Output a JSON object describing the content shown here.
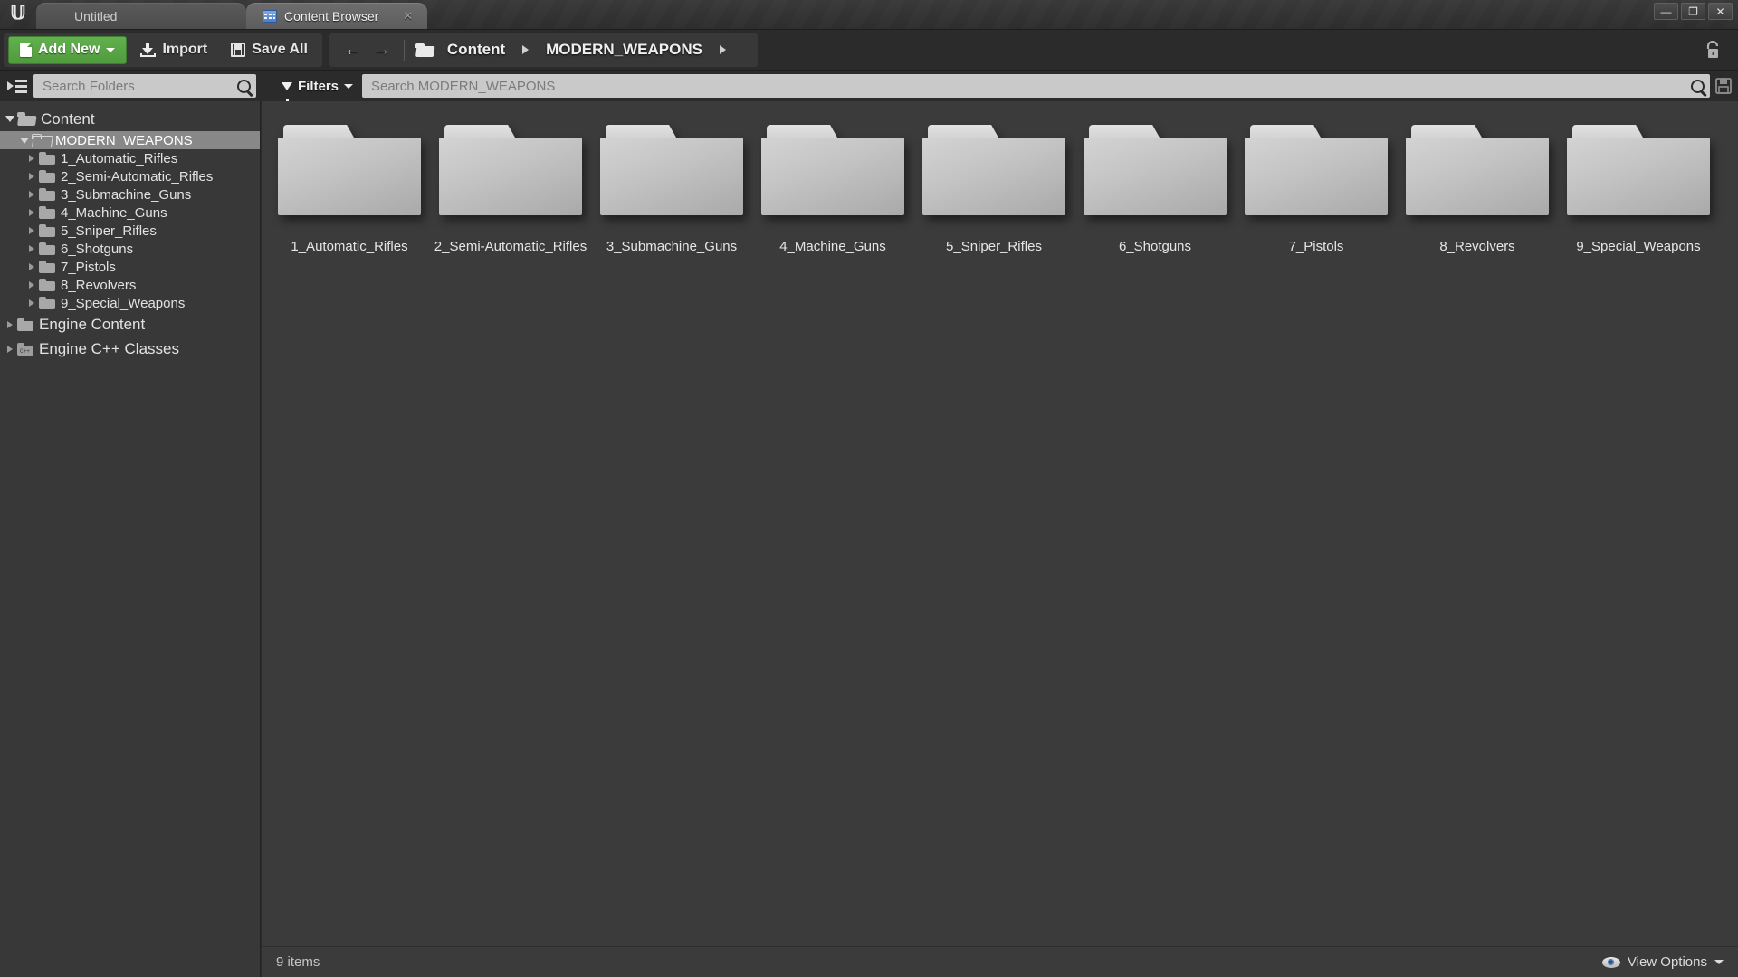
{
  "window": {
    "logo": "unreal-engine-logo",
    "controls": [
      {
        "name": "minimize-button",
        "glyph": "—"
      },
      {
        "name": "restore-button",
        "glyph": "❐"
      },
      {
        "name": "close-button",
        "glyph": "✕"
      }
    ]
  },
  "tabs": [
    {
      "label": "Untitled",
      "active": false,
      "icon": null
    },
    {
      "label": "Content Browser",
      "active": true,
      "icon": "content-browser-icon",
      "close": "✕"
    }
  ],
  "toolbar": {
    "add_new_label": "Add New",
    "import_label": "Import",
    "save_all_label": "Save All",
    "back_arrow": "←",
    "forward_arrow": "→",
    "lock_icon": "unlocked-padlock-icon"
  },
  "breadcrumb": {
    "folder_icon": "open-folder-icon",
    "items": [
      "Content",
      "MODERN_WEAPONS"
    ],
    "separator": "▶"
  },
  "search": {
    "folder_placeholder": "Search Folders",
    "folder_value": "",
    "asset_placeholder": "Search MODERN_WEAPONS",
    "asset_value": "",
    "filters_label": "Filters",
    "save_search_icon": "save-search-icon",
    "panel_toggle_icon": "collapse-panel-icon"
  },
  "sidebar": {
    "items": [
      {
        "label": "Content",
        "level": 0,
        "expanded": true,
        "selected": false,
        "icon": "open-folder-icon"
      },
      {
        "label": "MODERN_WEAPONS",
        "level": 1,
        "expanded": true,
        "selected": true,
        "icon": "open-folder-outline-icon"
      },
      {
        "label": "1_Automatic_Rifles",
        "level": 2,
        "expanded": false,
        "selected": false,
        "icon": "folder-icon"
      },
      {
        "label": "2_Semi-Automatic_Rifles",
        "level": 2,
        "expanded": false,
        "selected": false,
        "icon": "folder-icon"
      },
      {
        "label": "3_Submachine_Guns",
        "level": 2,
        "expanded": false,
        "selected": false,
        "icon": "folder-icon"
      },
      {
        "label": "4_Machine_Guns",
        "level": 2,
        "expanded": false,
        "selected": false,
        "icon": "folder-icon"
      },
      {
        "label": "5_Sniper_Rifles",
        "level": 2,
        "expanded": false,
        "selected": false,
        "icon": "folder-icon"
      },
      {
        "label": "6_Shotguns",
        "level": 2,
        "expanded": false,
        "selected": false,
        "icon": "folder-icon"
      },
      {
        "label": "7_Pistols",
        "level": 2,
        "expanded": false,
        "selected": false,
        "icon": "folder-icon"
      },
      {
        "label": "8_Revolvers",
        "level": 2,
        "expanded": false,
        "selected": false,
        "icon": "folder-icon"
      },
      {
        "label": "9_Special_Weapons",
        "level": 2,
        "expanded": false,
        "selected": false,
        "icon": "folder-icon"
      },
      {
        "label": "Engine Content",
        "level": 0,
        "expanded": false,
        "selected": false,
        "icon": "folder-icon"
      },
      {
        "label": "Engine C++ Classes",
        "level": 0,
        "expanded": false,
        "selected": false,
        "icon": "cpp-folder-icon"
      }
    ]
  },
  "main": {
    "tiles": [
      {
        "label": "1_Automatic_Rifles"
      },
      {
        "label": "2_Semi-Automatic_Rifles"
      },
      {
        "label": "3_Submachine_Guns"
      },
      {
        "label": "4_Machine_Guns"
      },
      {
        "label": "5_Sniper_Rifles"
      },
      {
        "label": "6_Shotguns"
      },
      {
        "label": "7_Pistols"
      },
      {
        "label": "8_Revolvers"
      },
      {
        "label": "9_Special_Weapons"
      }
    ]
  },
  "statusbar": {
    "item_count": "9 items",
    "view_options_label": "View Options"
  },
  "colors": {
    "accent_green": "#4f9b3d",
    "panel_bg": "#383838",
    "content_bg": "#3b3b3b",
    "toolbar_bg": "#2b2b2b",
    "selection": "#888888",
    "search_field": "#c9c9c9"
  }
}
